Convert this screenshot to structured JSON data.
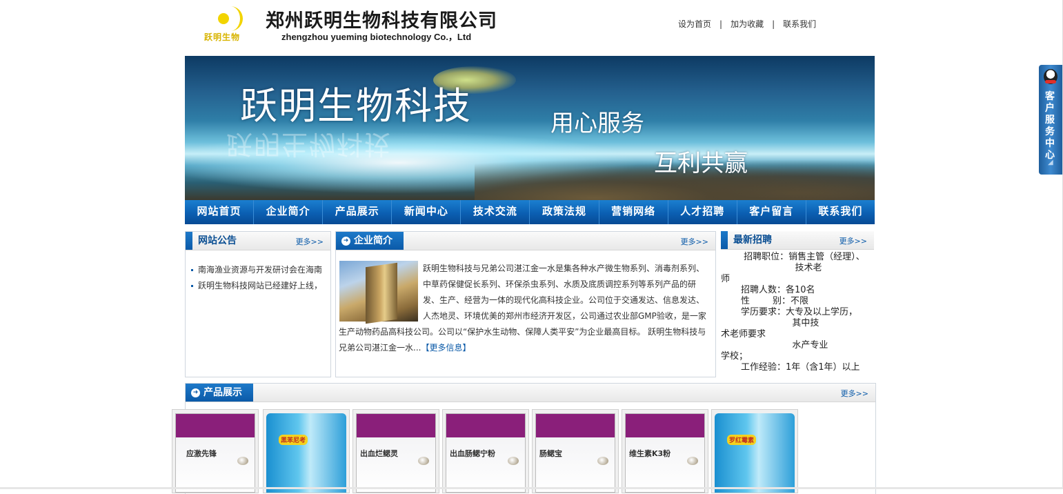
{
  "header": {
    "logo_text": "跃明生物",
    "company_name": "郑州跃明生物科技有限公司",
    "company_en": "zhengzhou yueming biotechnology  Co.，Ltd",
    "top_links": [
      "设为首页",
      "加为收藏",
      "联系我们"
    ],
    "separator": "|"
  },
  "banner": {
    "title": "跃明生物科技",
    "slogan1": "用心服务",
    "slogan2": "互利共赢",
    "mirror": "跃明生物科技"
  },
  "nav": [
    "网站首页",
    "企业简介",
    "产品展示",
    "新闻中心",
    "技术交流",
    "政策法规",
    "营销网络",
    "人才招聘",
    "客户留言",
    "联系我们"
  ],
  "more_label": "更多>>",
  "notice": {
    "title": "网站公告",
    "items": [
      "南海渔业资源与开发研讨会在海南",
      "跃明生物科技网站已经建好上线，"
    ]
  },
  "intro": {
    "title": "企业简介",
    "text": "跃明生物科技与兄弟公司湛江金一水是集各种水产微生物系列、消毒剂系列、中草药保健促长系列、环保杀虫系列、水质及底质调控系列等系列产品的研发、生产、经营为一体的现代化高科技企业。公司位于交通发达、信息发达、人杰地灵、环境优美的郑州市经济开发区，公司通过农业部GMP验收，是一家生产动物药品高科技公司。公司以“保护水生动物、保障人类平安”为企业最高目标。 跃明生物科技与兄弟公司湛江金一水...",
    "more": "【更多信息】"
  },
  "recruit": {
    "title": "最新招聘",
    "body": "        招聘职位：销售主管（经理）、\n                          技术老\n师\n       招聘人数：各10名\n       性        别：不限\n       学历要求：大专及以上学历，\n                         其中技\n术老师要求\n                         水产专业\n学校；\n       工作经验：1年（含1年）以上"
  },
  "products": {
    "title": "产品展示",
    "items": [
      {
        "name": "应激先锋",
        "style": "purple"
      },
      {
        "name": "黑苯尼考",
        "style": "blue"
      },
      {
        "name": "出血烂鳃灵",
        "style": "purple"
      },
      {
        "name": "出血肠鳃宁粉",
        "style": "purple"
      },
      {
        "name": "肠鳃宝",
        "style": "purple"
      },
      {
        "name": "维生素K3粉",
        "style": "purple"
      },
      {
        "name": "罗红霉素",
        "style": "blue"
      }
    ]
  },
  "side_service": {
    "label": "客户服务中心"
  }
}
